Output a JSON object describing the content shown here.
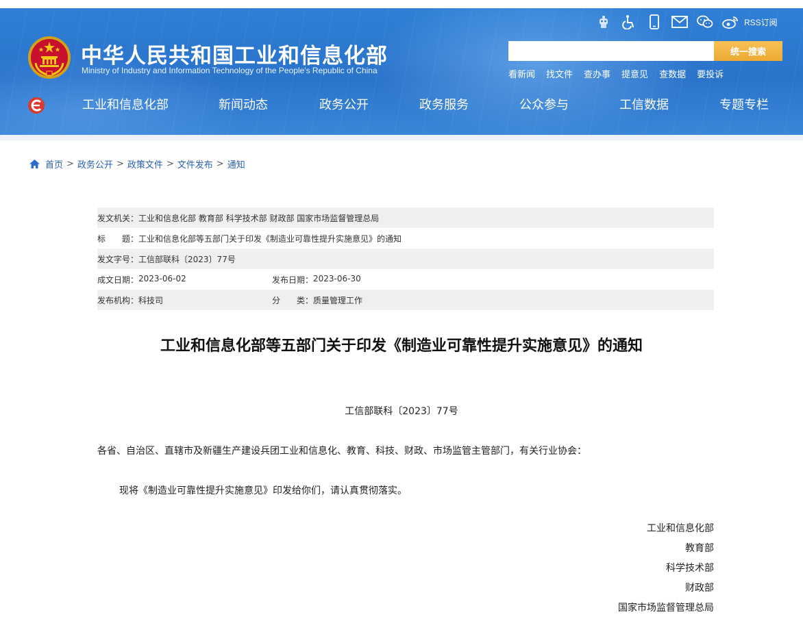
{
  "header": {
    "title": "中华人民共和国工业和信息化部",
    "subtitle": "Ministry of Industry and Information Technology of the People's Republic of China",
    "rss_label": "RSS订阅",
    "icons": [
      "robot-icon",
      "accessibility-icon",
      "mobile-icon",
      "mail-icon",
      "wechat-icon",
      "weibo-icon"
    ]
  },
  "search": {
    "placeholder": "",
    "button_label": "统一搜索"
  },
  "quick_links": [
    "看新闻",
    "找文件",
    "查办事",
    "提意见",
    "查数据",
    "要投诉"
  ],
  "nav": [
    "工业和信息化部",
    "新闻动态",
    "政务公开",
    "政务服务",
    "公众参与",
    "工信数据",
    "专题专栏"
  ],
  "breadcrumb": {
    "items": [
      "首页",
      "政务公开",
      "政策文件",
      "文件发布",
      "通知"
    ],
    "separator": ">"
  },
  "meta": {
    "issuer_label": "发文机关：",
    "issuer": "工业和信息化部 教育部 科学技术部 财政部 国家市场监督管理总局",
    "title_label": "标　　题：",
    "title": "工业和信息化部等五部门关于印发《制造业可靠性提升实施意见》的通知",
    "docno_label": "发文字号：",
    "docno": "工信部联科〔2023〕77号",
    "created_label": "成文日期：",
    "created": "2023-06-02",
    "published_label": "发布日期：",
    "published": "2023-06-30",
    "org_label": "发布机构：",
    "org": "科技司",
    "category_label": "分　　类：",
    "category": "质量管理工作"
  },
  "article": {
    "title": "工业和信息化部等五部门关于印发《制造业可靠性提升实施意见》的通知",
    "doc_number": "工信部联科〔2023〕77号",
    "salutation": "各省、自治区、直辖市及新疆生产建设兵团工业和信息化、教育、科技、财政、市场监管主管部门，有关行业协会：",
    "body": "现将《制造业可靠性提升实施意见》印发给你们，请认真贯彻落实。",
    "signers": [
      "工业和信息化部",
      "教育部",
      "科学技术部",
      "财政部",
      "国家市场监督管理总局"
    ]
  },
  "colors": {
    "header_blue": "#2a73cb",
    "search_button": "#eda932",
    "link_blue": "#2a5fb0",
    "meta_shade": "#efefef"
  }
}
